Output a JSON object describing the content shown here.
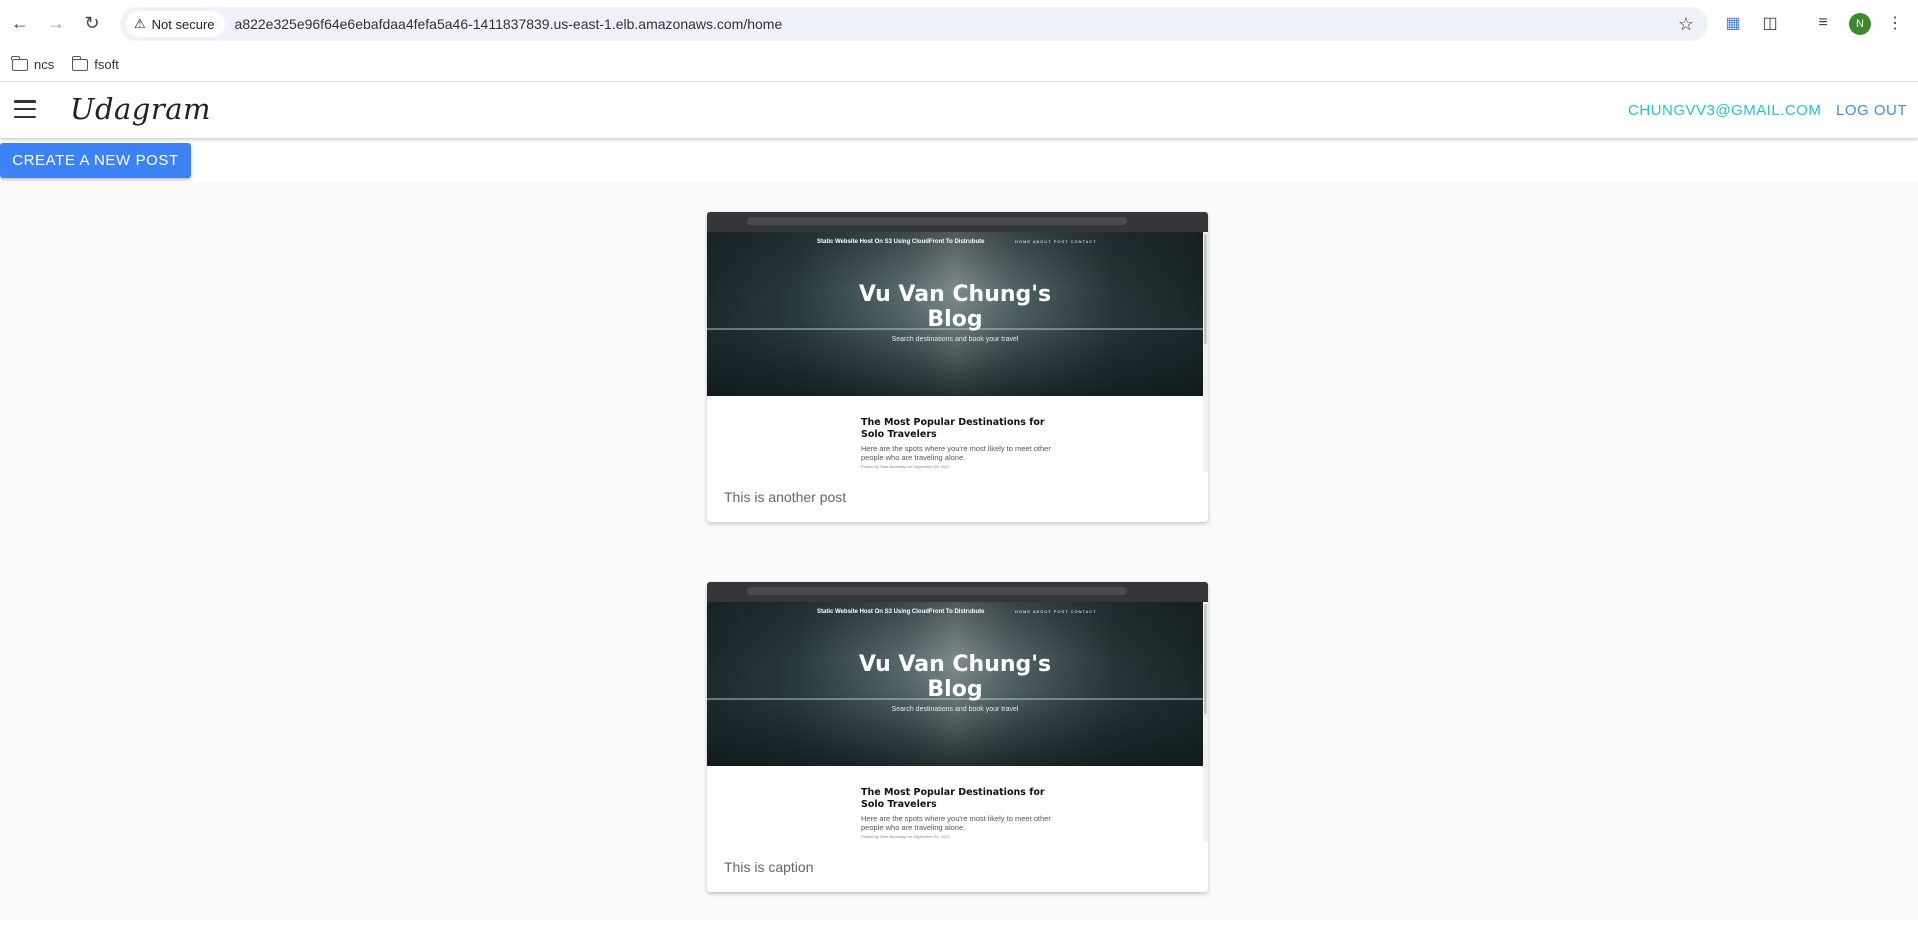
{
  "browser": {
    "security_label": "Not secure",
    "url": "a822e325e96f64e6ebafdaa4fefa5a46-1411837839.us-east-1.elb.amazonaws.com/home",
    "profile_initial": "N",
    "bookmarks": [
      {
        "label": "ncs"
      },
      {
        "label": "fsoft"
      }
    ]
  },
  "toolbar": {
    "brand": "Udagram",
    "user_email": "CHUNGVV3@GMAIL.COM",
    "logout_label": "LOG OUT"
  },
  "main": {
    "create_button": "CREATE A NEW POST"
  },
  "posts": [
    {
      "caption": "This is another post",
      "screenshot": {
        "site_title": "Static Website Host On S3 Using CloudFront To Distrubute",
        "nav": "HOME ABOUT POST CONTACT",
        "blog_title_line1": "Vu Van Chung's",
        "blog_title_line2": "Blog",
        "subtitle": "Search destinations and book your travel",
        "article_title": "The Most Popular Destinations for Solo Travelers",
        "article_text": "Here are the spots where you're most likely to meet other people who are traveling alone.",
        "article_meta": "Posted by Start Bootstrap on September 24, 2023"
      }
    },
    {
      "caption": "This is caption",
      "screenshot": {
        "site_title": "Static Website Host On S3 Using CloudFront To Distrubute",
        "nav": "HOME ABOUT POST CONTACT",
        "blog_title_line1": "Vu Van Chung's",
        "blog_title_line2": "Blog",
        "subtitle": "Search destinations and book your travel",
        "article_title": "The Most Popular Destinations for Solo Travelers",
        "article_text": "Here are the spots where you're most likely to meet other people who are traveling alone.",
        "article_meta": "Posted by Start Bootstrap on September 24, 2023"
      }
    }
  ],
  "colors": {
    "accent_button": "#3d82f5",
    "user_link": "#26c0d3",
    "logout_link": "#3b8fdd",
    "feed_background": "#fafafa"
  },
  "icons": [
    "back-arrow-icon",
    "forward-arrow-icon",
    "reload-icon",
    "warning-icon",
    "star-icon",
    "translate-icon",
    "extensions-icon",
    "media-icon",
    "more-vert-icon",
    "folder-icon",
    "menu-icon"
  ]
}
